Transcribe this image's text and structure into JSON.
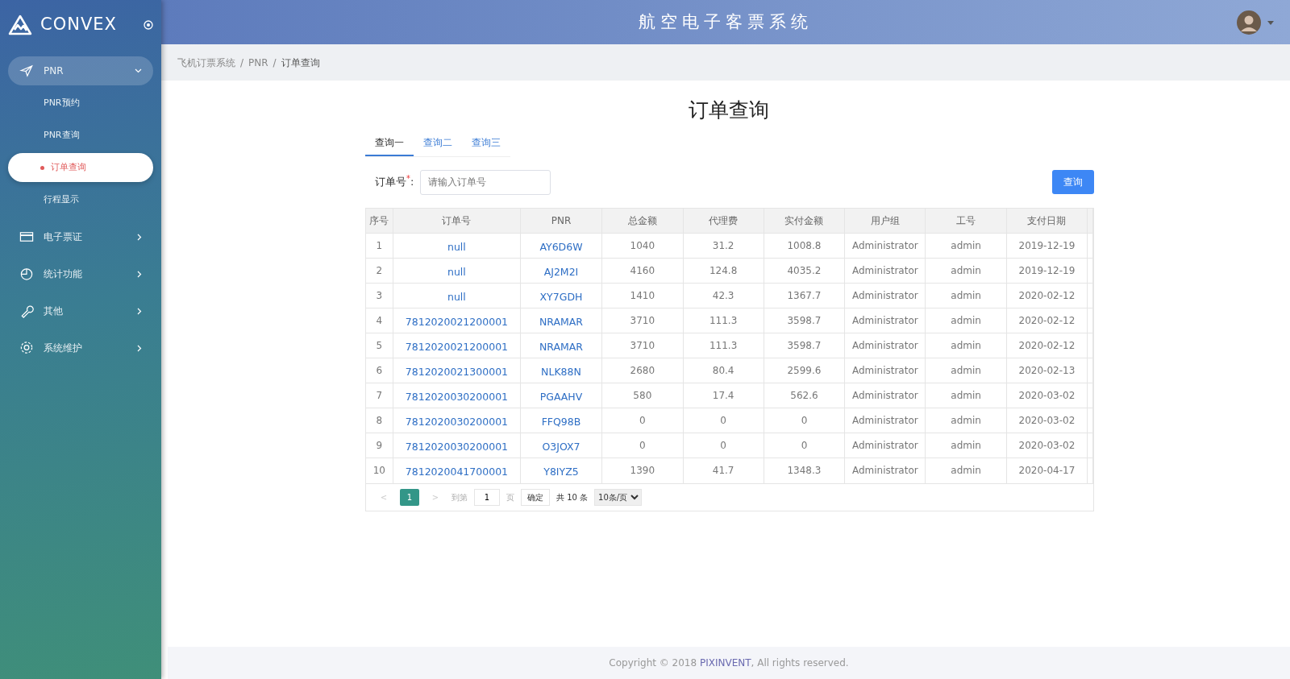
{
  "brand": {
    "name": "CONVEX"
  },
  "header": {
    "title": "航空电子客票系统"
  },
  "sidebar": {
    "items": [
      {
        "label": "PNR",
        "expanded": true,
        "children": [
          {
            "label": "PNR预约",
            "selected": false
          },
          {
            "label": "PNR查询",
            "selected": false
          },
          {
            "label": "订单查询",
            "selected": true
          },
          {
            "label": "行程显示",
            "selected": false
          }
        ]
      },
      {
        "label": "电子票证",
        "expanded": false
      },
      {
        "label": "统计功能",
        "expanded": false
      },
      {
        "label": "其他",
        "expanded": false
      },
      {
        "label": "系统维护",
        "expanded": false
      }
    ]
  },
  "breadcrumb": {
    "separator": "/",
    "items": [
      "飞机订票系统",
      "PNR",
      "订单查询"
    ]
  },
  "page_title": "订单查询",
  "tabs": [
    {
      "label": "查询一",
      "selected": true
    },
    {
      "label": "查询二",
      "selected": false
    },
    {
      "label": "查询三",
      "selected": false
    }
  ],
  "search_form": {
    "label": "订单号",
    "required_mark": "*",
    "colon": ":",
    "placeholder": "请输入订单号",
    "button": "查询"
  },
  "table": {
    "columns": [
      "序号",
      "订单号",
      "PNR",
      "总金额",
      "代理费",
      "实付金额",
      "用户组",
      "工号",
      "支付日期"
    ],
    "rows": [
      [
        "1",
        "null",
        "AY6D6W",
        "1040",
        "31.2",
        "1008.8",
        "Administrator",
        "admin",
        "2019-12-19"
      ],
      [
        "2",
        "null",
        "AJ2M2I",
        "4160",
        "124.8",
        "4035.2",
        "Administrator",
        "admin",
        "2019-12-19"
      ],
      [
        "3",
        "null",
        "XY7GDH",
        "1410",
        "42.3",
        "1367.7",
        "Administrator",
        "admin",
        "2020-02-12"
      ],
      [
        "4",
        "7812020021200001",
        "NRAMAR",
        "3710",
        "111.3",
        "3598.7",
        "Administrator",
        "admin",
        "2020-02-12"
      ],
      [
        "5",
        "7812020021200001",
        "NRAMAR",
        "3710",
        "111.3",
        "3598.7",
        "Administrator",
        "admin",
        "2020-02-12"
      ],
      [
        "6",
        "7812020021300001",
        "NLK88N",
        "2680",
        "80.4",
        "2599.6",
        "Administrator",
        "admin",
        "2020-02-13"
      ],
      [
        "7",
        "7812020030200001",
        "PGAAHV",
        "580",
        "17.4",
        "562.6",
        "Administrator",
        "admin",
        "2020-03-02"
      ],
      [
        "8",
        "7812020030200001",
        "FFQ98B",
        "0",
        "0",
        "0",
        "Administrator",
        "admin",
        "2020-03-02"
      ],
      [
        "9",
        "7812020030200001",
        "O3JOX7",
        "0",
        "0",
        "0",
        "Administrator",
        "admin",
        "2020-03-02"
      ],
      [
        "10",
        "7812020041700001",
        "Y8IYZ5",
        "1390",
        "41.7",
        "1348.3",
        "Administrator",
        "admin",
        "2020-04-17"
      ]
    ]
  },
  "pagination": {
    "prev": "<",
    "pages": [
      {
        "label": "1",
        "selected": true
      }
    ],
    "next": ">",
    "goto_label": "到第",
    "goto_value": "1",
    "page_unit": "页",
    "confirm": "确定",
    "total": "共 10 条",
    "page_size": "10条/页"
  },
  "footer": {
    "before": "Copyright © 2018",
    "link": "PIXINVENT",
    "after": ", All rights reserved."
  }
}
